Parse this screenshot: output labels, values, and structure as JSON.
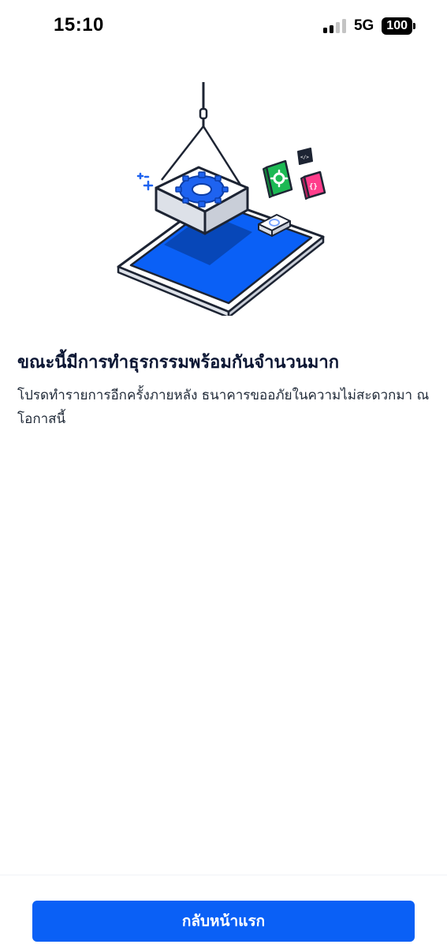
{
  "status_bar": {
    "time": "15:10",
    "network": "5G",
    "battery": "100"
  },
  "illustration": {
    "description_icon": "crane-lifting-gear-onto-phone-icon",
    "accent_color": "#0a60f6"
  },
  "message": {
    "title": "ขณะนี้มีการทำธุรกรรมพร้อมกันจำนวนมาก",
    "body": "โปรดทำรายการอีกครั้งภายหลัง ธนาคารขออภัยในความไม่สะดวกมา ณ โอกาสนี้"
  },
  "actions": {
    "back_home_label": "กลับหน้าแรก",
    "button_color": "#0a60f6"
  }
}
